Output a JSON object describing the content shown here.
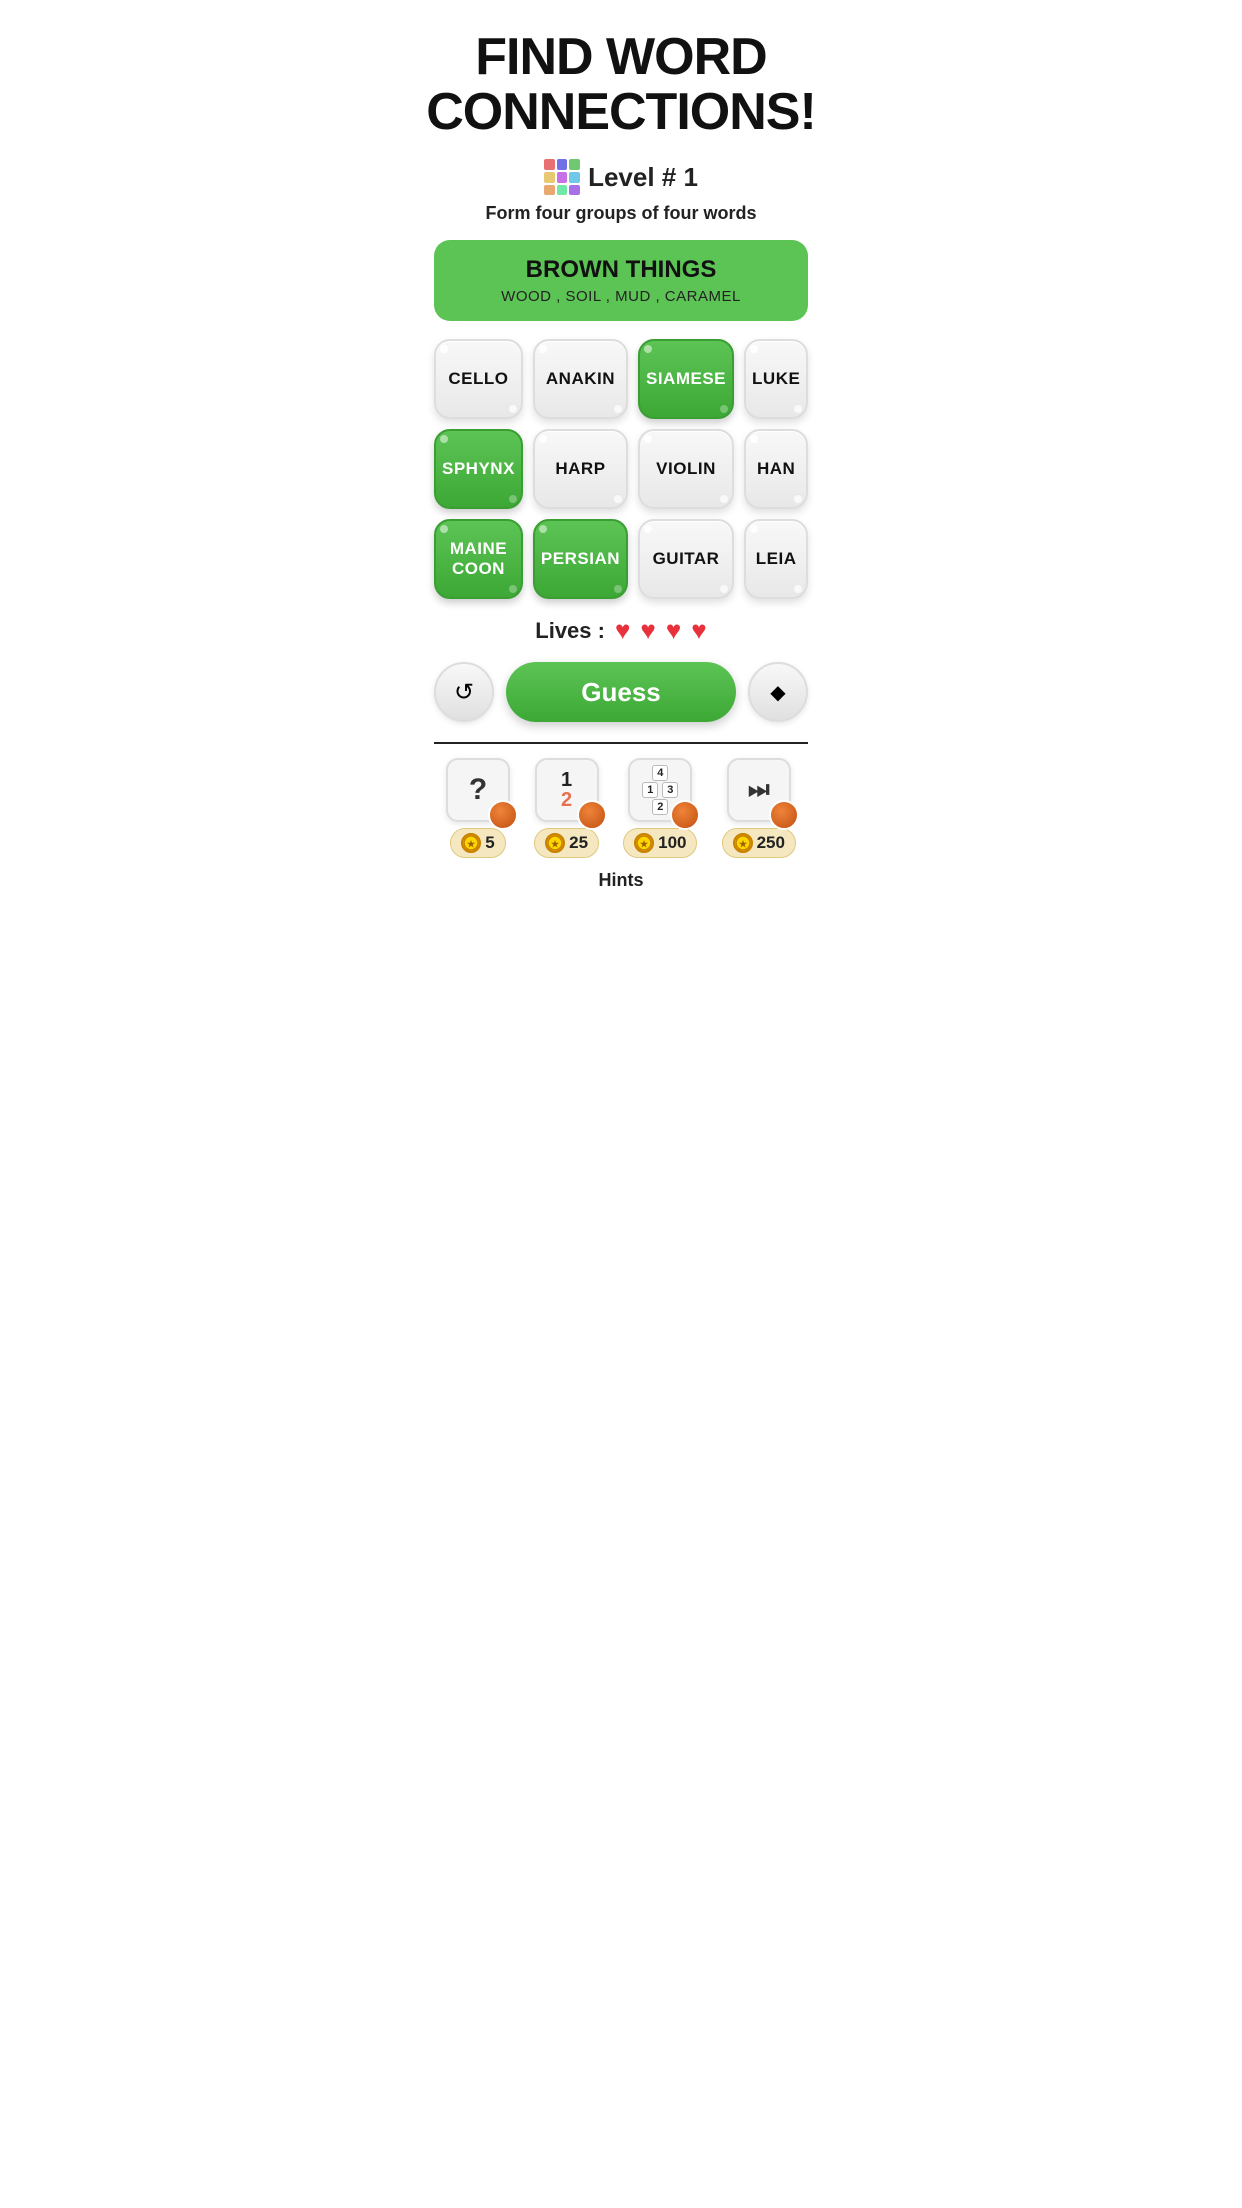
{
  "title": "FIND WORD CONNECTIONS!",
  "level": {
    "label": "Level # 1",
    "icon_colors": [
      "#e87070",
      "#7070e8",
      "#70c870",
      "#e8c870",
      "#c870e8",
      "#70c8e8",
      "#e8a870",
      "#70e8a8",
      "#a870e8"
    ]
  },
  "subtitle": "Form four groups of four words",
  "solved_category": {
    "title": "BROWN THINGS",
    "words": "WOOD , SOIL , MUD , CARAMEL"
  },
  "tiles": [
    {
      "label": "CELLO",
      "state": "white"
    },
    {
      "label": "ANAKIN",
      "state": "white"
    },
    {
      "label": "SIAMESE",
      "state": "green"
    },
    {
      "label": "LUKE",
      "state": "white"
    },
    {
      "label": "SPHYNX",
      "state": "green"
    },
    {
      "label": "HARP",
      "state": "white"
    },
    {
      "label": "VIOLIN",
      "state": "white"
    },
    {
      "label": "HAN",
      "state": "white"
    },
    {
      "label": "MAINE COON",
      "state": "green"
    },
    {
      "label": "PERSIAN",
      "state": "green"
    },
    {
      "label": "GUITAR",
      "state": "white"
    },
    {
      "label": "LEIA",
      "state": "white"
    }
  ],
  "lives": {
    "label": "Lives :",
    "count": 4,
    "hearts": [
      "♥",
      "♥",
      "♥",
      "♥"
    ]
  },
  "actions": {
    "shuffle_label": "↺",
    "guess_label": "Guess",
    "erase_label": "◆"
  },
  "hints": [
    {
      "icon": "?",
      "cost": "5",
      "type": "question"
    },
    {
      "icon": "12",
      "cost": "25",
      "type": "swap"
    },
    {
      "icon": "123",
      "cost": "100",
      "type": "arrange"
    },
    {
      "icon": "▶|",
      "cost": "250",
      "type": "skip"
    }
  ],
  "hints_label": "Hints"
}
